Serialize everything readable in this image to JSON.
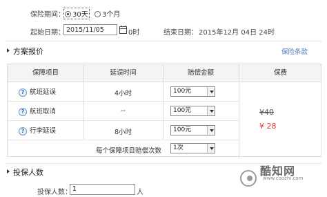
{
  "period": {
    "label": "保险期间：",
    "options": [
      "30天",
      "3个月"
    ]
  },
  "dates": {
    "start_label": "起始日期：",
    "start_value": "2015/11/05",
    "start_hour": "0时",
    "end_label": "结束日期：",
    "end_value": "2015年12月 04日 24时"
  },
  "plan": {
    "title": "方案报价",
    "terms_link": "保险条款"
  },
  "table": {
    "headers": [
      "保障项目",
      "延误时间",
      "赔偿金额",
      "保费"
    ],
    "rows": [
      {
        "item": "航班延误",
        "delay": "4小时",
        "amount": "100元"
      },
      {
        "item": "航班取消",
        "delay": "--",
        "amount": "100元"
      },
      {
        "item": "行李延误",
        "delay": "8小时",
        "amount": "100元"
      }
    ],
    "claims_label": "每个保障项目赔偿次数",
    "claims_value": "1次",
    "original_price": "¥40",
    "price": "¥ 28"
  },
  "insured": {
    "title": "投保人数",
    "count_label": "投保人数：",
    "count_value": "1",
    "unit": "人"
  },
  "watermark": {
    "name": "酷知网",
    "url": "www.coozhi.com"
  },
  "colors": {
    "price": "#e23b2e",
    "link": "#4a7ab5"
  }
}
